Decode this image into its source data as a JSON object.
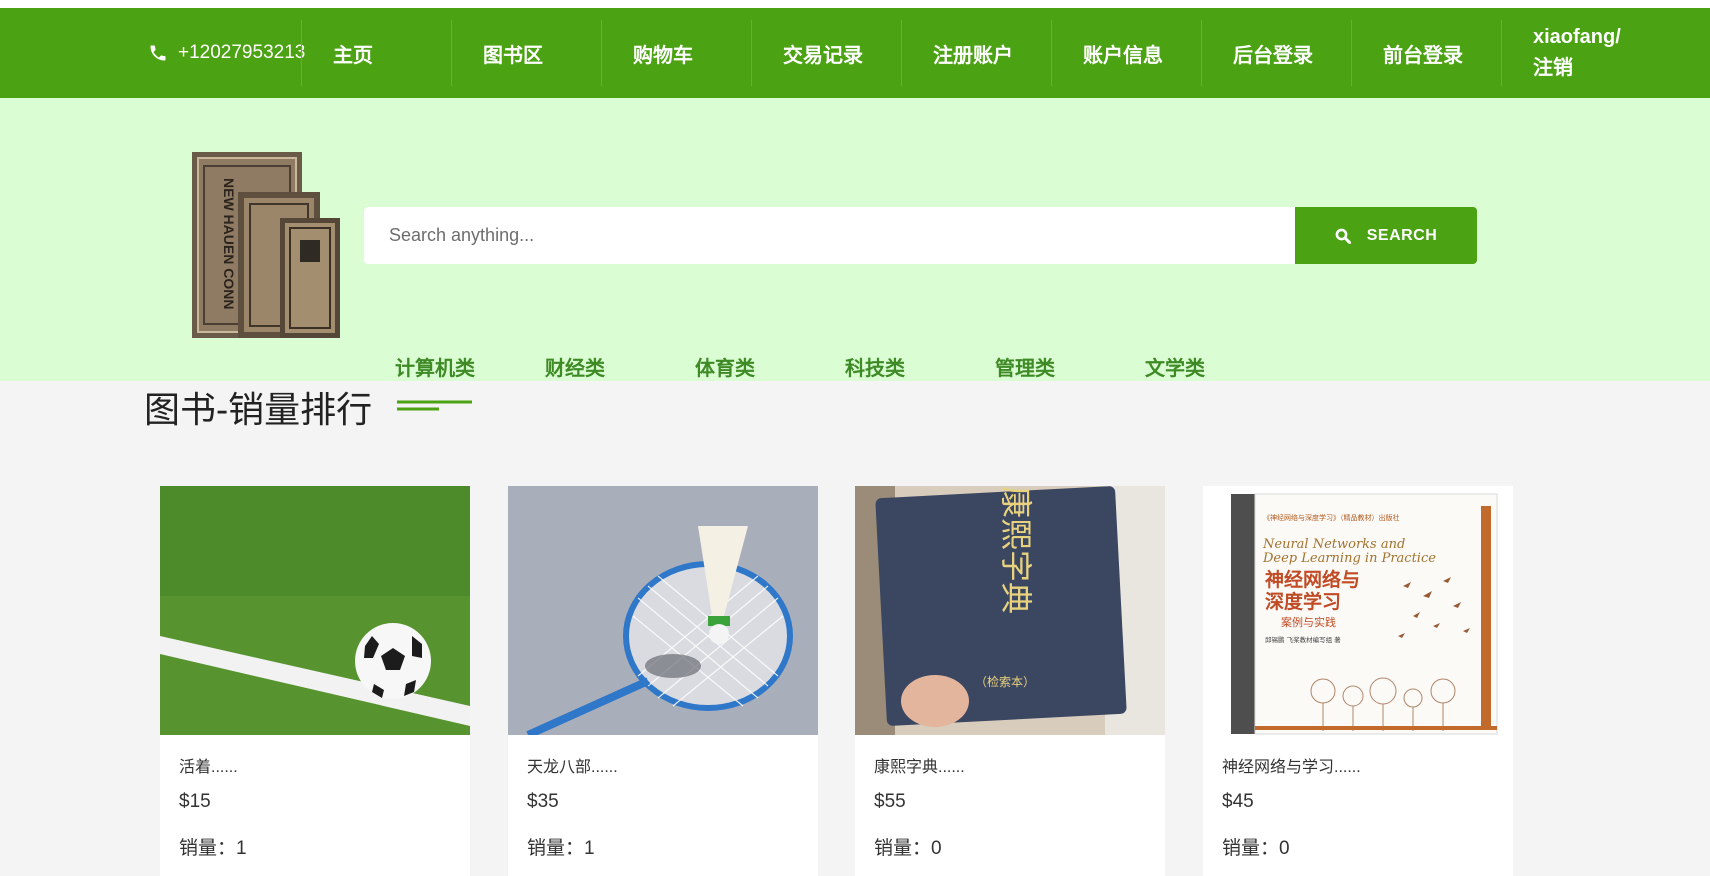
{
  "nav": {
    "phone": "+12027953213",
    "items": [
      {
        "label": "主页"
      },
      {
        "label": "图书区"
      },
      {
        "label": "购物车"
      },
      {
        "label": "交易记录"
      },
      {
        "label": "注册账户"
      },
      {
        "label": "账户信息"
      },
      {
        "label": "后台登录"
      },
      {
        "label": "前台登录"
      }
    ],
    "user_line1": "xiaofang/",
    "user_line2": "注销"
  },
  "search": {
    "placeholder": "Search anything...",
    "button_label": "SEARCH"
  },
  "categories": [
    "计算机类",
    "财经类",
    "体育类",
    "科技类",
    "管理类",
    "文学类"
  ],
  "section": {
    "title": "图书-销量排行"
  },
  "products": [
    {
      "name": "活着......",
      "price": "$15",
      "sales": "销量：1"
    },
    {
      "name": "天龙八部......",
      "price": "$35",
      "sales": "销量：1"
    },
    {
      "name": "康熙字典......",
      "price": "$55",
      "sales": "销量：0"
    },
    {
      "name": "神经网络与学习......",
      "price": "$45",
      "sales": "销量：0"
    }
  ],
  "book_cover": {
    "kangxi_title": "康熙字典",
    "kangxi_sub": "（检索本）",
    "nn_series": "《神经网络与深度学习》（精品教材）出版社",
    "nn_en_1": "Neural Networks and",
    "nn_en_2": "Deep Learning in Practice",
    "nn_cn_1": "神经网络与",
    "nn_cn_2": "深度学习",
    "nn_sub": "案例与实践",
    "nn_authors": "邱锡鹏 飞桨教材编写组 著"
  },
  "logo_text": "NEW HAUEN CONN",
  "colors": {
    "nav_bg": "#4ba212",
    "hero_bg": "#dbfdd3",
    "category_text": "#3e8b26",
    "page_bg": "#f4f4f4"
  }
}
